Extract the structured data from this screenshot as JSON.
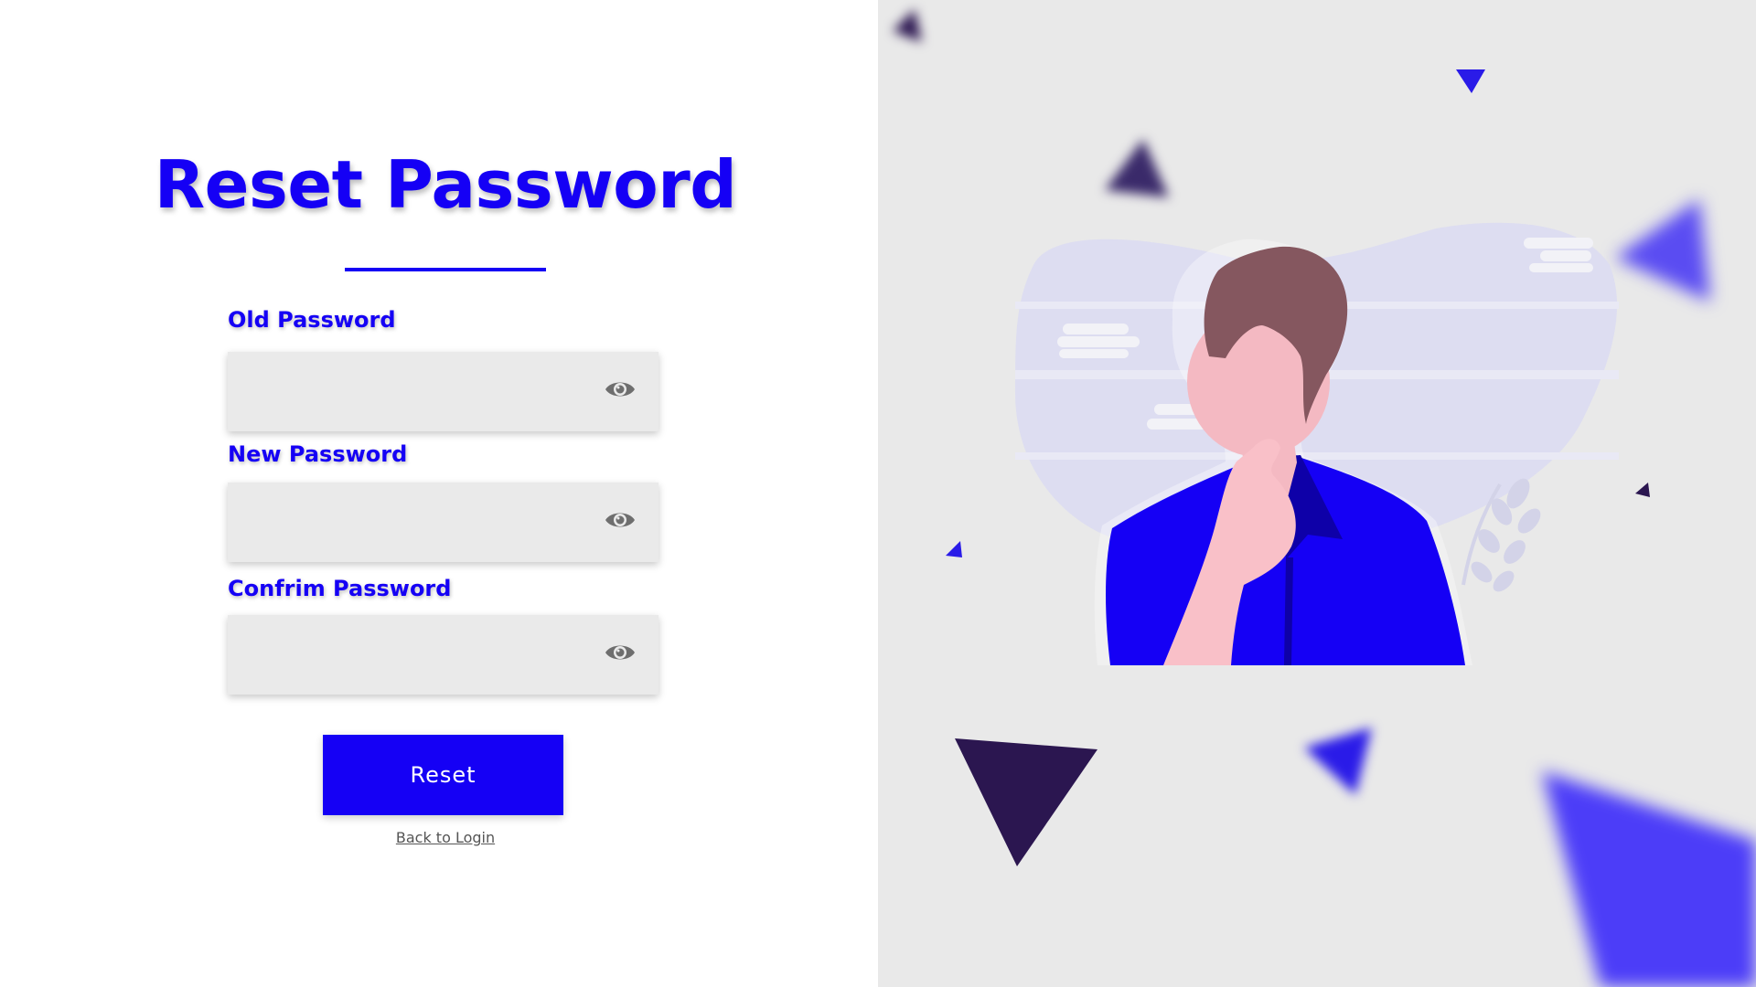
{
  "form": {
    "title": "Reset Password",
    "fields": [
      {
        "label": "Old Password",
        "value": "",
        "icon": "eye-icon"
      },
      {
        "label": "New Password",
        "value": "",
        "icon": "eye-icon"
      },
      {
        "label": "Confrim Password",
        "value": "",
        "icon": "eye-icon"
      }
    ],
    "submit_label": "Reset",
    "back_link": "Back to Login"
  },
  "colors": {
    "accent": "#1500f5",
    "dark_triangle": "#2b1650",
    "field_bg": "#eaeaea",
    "illustration_bg": "#e9e9e9"
  },
  "illustration": {
    "description_icon": "thinking-person-illustration"
  }
}
